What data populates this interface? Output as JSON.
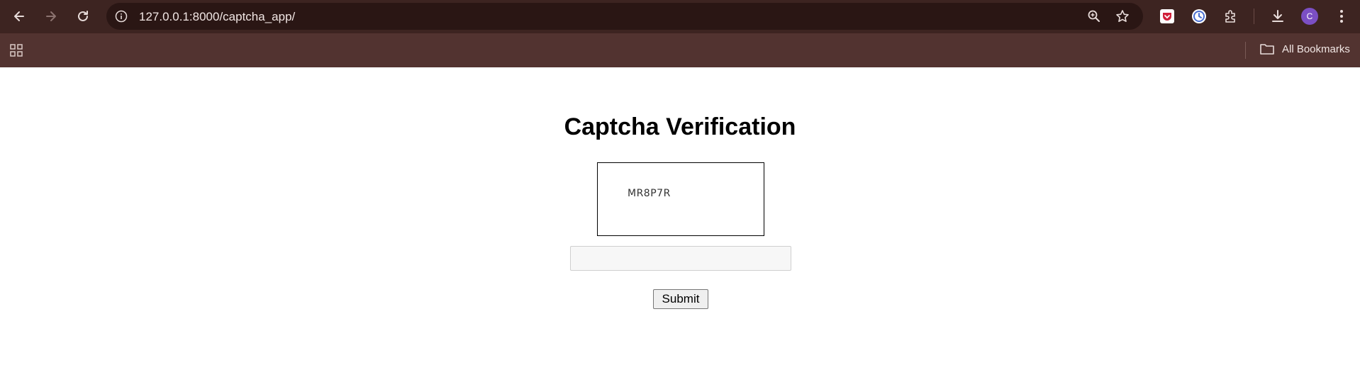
{
  "browser": {
    "url": "127.0.0.1:8000/captcha_app/",
    "profile_initial": "C",
    "bookmarks_label": "All Bookmarks",
    "icons": [
      "back-icon",
      "forward-icon",
      "reload-icon",
      "site-info-icon",
      "zoom-icon",
      "star-icon",
      "pocket-icon",
      "history-extension-icon",
      "extensions-icon",
      "download-icon",
      "profile-avatar",
      "menu-icon",
      "apps-icon",
      "folder-icon"
    ],
    "colors": {
      "toolbar": "#3d2421",
      "omnibox": "#2a1614",
      "bookmarks_bar": "#523330",
      "profile_avatar": "#7b4fc4"
    }
  },
  "page": {
    "title": "Captcha Verification",
    "captcha_code": "MR8P7R",
    "input_value": "",
    "submit_label": "Submit"
  }
}
